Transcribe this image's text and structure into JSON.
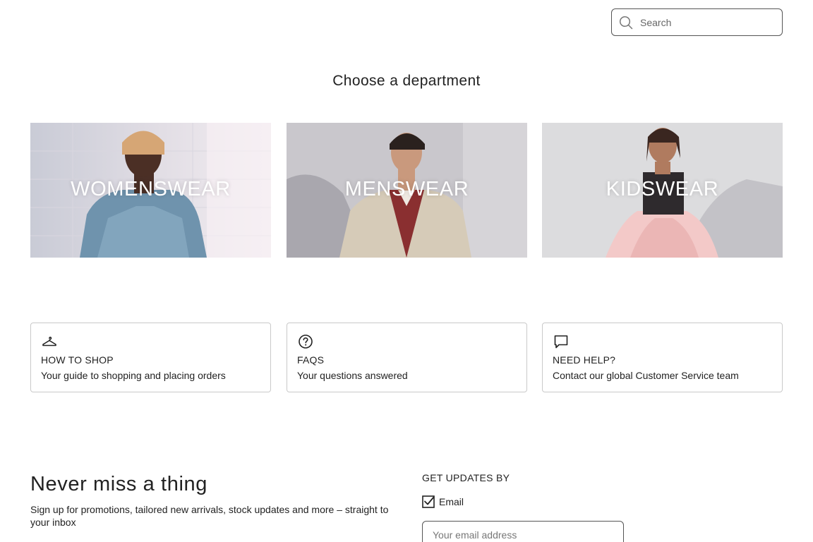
{
  "search": {
    "placeholder": "Search",
    "icon": "search-icon"
  },
  "heading": "Choose a department",
  "departments": [
    {
      "label": "WOMENSWEAR"
    },
    {
      "label": "MENSWEAR"
    },
    {
      "label": "KIDSWEAR"
    }
  ],
  "help_cards": [
    {
      "icon": "hanger-icon",
      "title": "HOW TO SHOP",
      "subtitle": "Your guide to shopping and placing orders"
    },
    {
      "icon": "question-circle-icon",
      "title": "FAQS",
      "subtitle": "Your questions answered"
    },
    {
      "icon": "chat-bubble-icon",
      "title": "NEED HELP?",
      "subtitle": "Contact our global Customer Service team"
    }
  ],
  "newsletter": {
    "title": "Never miss a thing",
    "text": "Sign up for promotions, tailored new arrivals, stock updates and more – straight to your inbox",
    "updates_label": "GET UPDATES BY",
    "email_option": "Email",
    "email_checked": true,
    "email_placeholder": "Your email address"
  }
}
